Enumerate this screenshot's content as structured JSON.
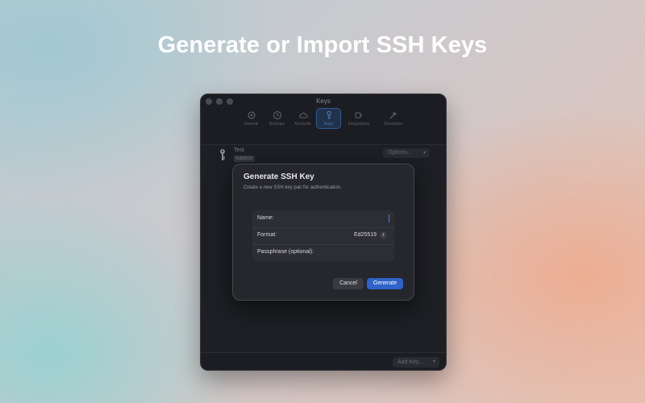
{
  "headline": "Generate or Import SSH Keys",
  "window": {
    "title": "Keys",
    "toolbar": [
      {
        "label": "General",
        "icon": "gear-icon"
      },
      {
        "label": "Backups",
        "icon": "clock-icon"
      },
      {
        "label": "Accounts",
        "icon": "cloud-icon"
      },
      {
        "label": "Keys",
        "icon": "key-icon",
        "active": true
      },
      {
        "label": "Integrations",
        "icon": "plug-icon"
      },
      {
        "label": "Developer",
        "icon": "hammer-icon"
      }
    ],
    "key_item": {
      "name": "Test",
      "format": "Ed25519"
    },
    "options_label": "Options...",
    "add_key_label": "Add Key..."
  },
  "dialog": {
    "title": "Generate SSH Key",
    "subtitle": "Create a new SSH key pair for authentication.",
    "fields": {
      "name_label": "Name:",
      "name_value": "",
      "format_label": "Format:",
      "format_value": "Ed25519",
      "passphrase_label": "Passphrase (optional):"
    },
    "cancel_label": "Cancel",
    "generate_label": "Generate"
  },
  "colors": {
    "accent": "#2f63c9",
    "window_bg": "#1e1f24",
    "dialog_bg": "#26272d"
  }
}
